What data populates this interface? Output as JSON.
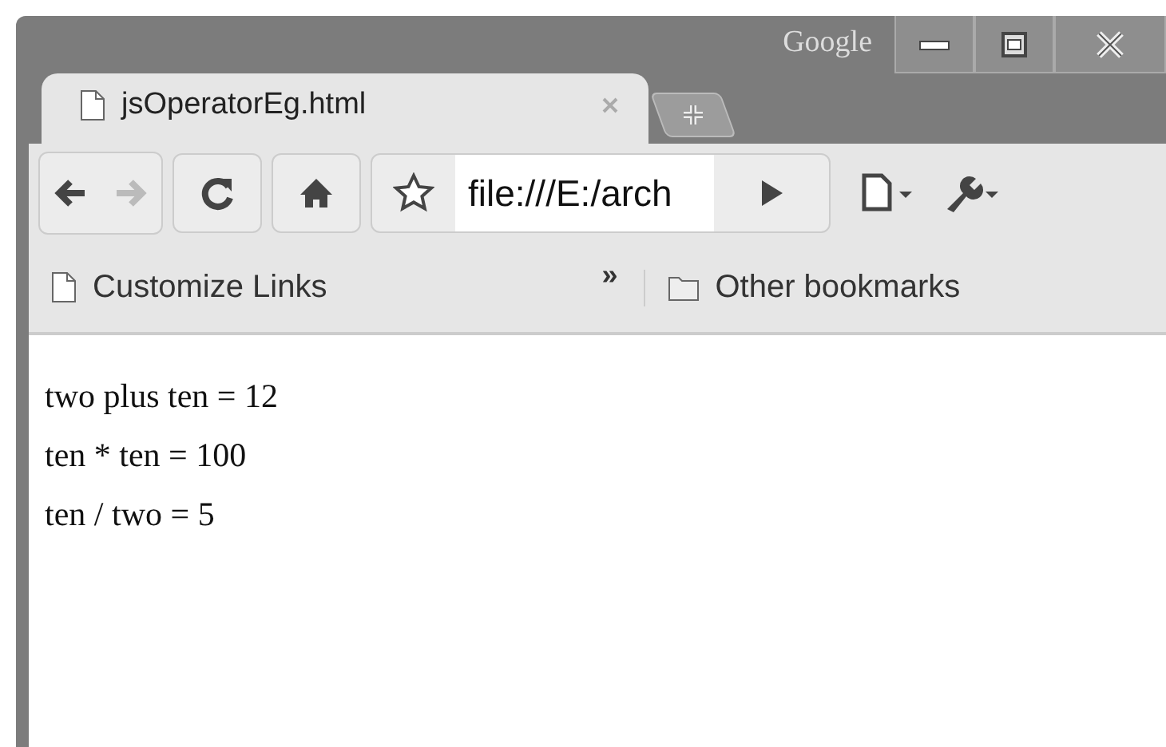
{
  "window": {
    "brand": "Google"
  },
  "tabs": [
    {
      "label": "jsOperatorEg.html",
      "selected": true
    }
  ],
  "toolbar": {
    "back_disabled": false,
    "forward_disabled": true,
    "address": "file:///E:/arch"
  },
  "bookmarks": {
    "items": [
      {
        "label": "Customize Links",
        "kind": "page"
      }
    ],
    "overflow": "»",
    "other": {
      "label": "Other bookmarks",
      "kind": "folder"
    }
  },
  "content": {
    "lines": [
      "two plus ten = 12",
      "ten * ten = 100",
      "ten / two = 5"
    ]
  }
}
